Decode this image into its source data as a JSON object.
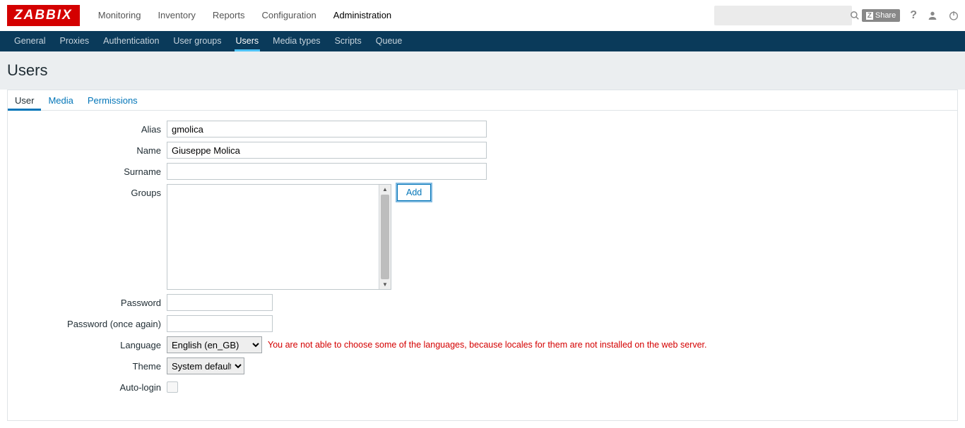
{
  "logo": "ZABBIX",
  "main_nav": {
    "items": [
      {
        "label": "Monitoring"
      },
      {
        "label": "Inventory"
      },
      {
        "label": "Reports"
      },
      {
        "label": "Configuration"
      },
      {
        "label": "Administration"
      }
    ],
    "active_index": 4
  },
  "header_right": {
    "share_label": "Share",
    "help_label": "?",
    "search_placeholder": ""
  },
  "sub_nav": {
    "items": [
      {
        "label": "General"
      },
      {
        "label": "Proxies"
      },
      {
        "label": "Authentication"
      },
      {
        "label": "User groups"
      },
      {
        "label": "Users"
      },
      {
        "label": "Media types"
      },
      {
        "label": "Scripts"
      },
      {
        "label": "Queue"
      }
    ],
    "active_index": 4
  },
  "page_title": "Users",
  "tabs": {
    "items": [
      {
        "label": "User"
      },
      {
        "label": "Media"
      },
      {
        "label": "Permissions"
      }
    ],
    "active_index": 0
  },
  "form": {
    "alias_label": "Alias",
    "alias_value": "gmolica",
    "name_label": "Name",
    "name_value": "Giuseppe Molica",
    "surname_label": "Surname",
    "surname_value": "",
    "groups_label": "Groups",
    "groups_add_btn": "Add",
    "password_label": "Password",
    "password_value": "",
    "password2_label": "Password (once again)",
    "password2_value": "",
    "language_label": "Language",
    "language_value": "English (en_GB)",
    "language_warning": "You are not able to choose some of the languages, because locales for them are not installed on the web server.",
    "theme_label": "Theme",
    "theme_value": "System default",
    "autologin_label": "Auto-login",
    "autologin_checked": false
  }
}
